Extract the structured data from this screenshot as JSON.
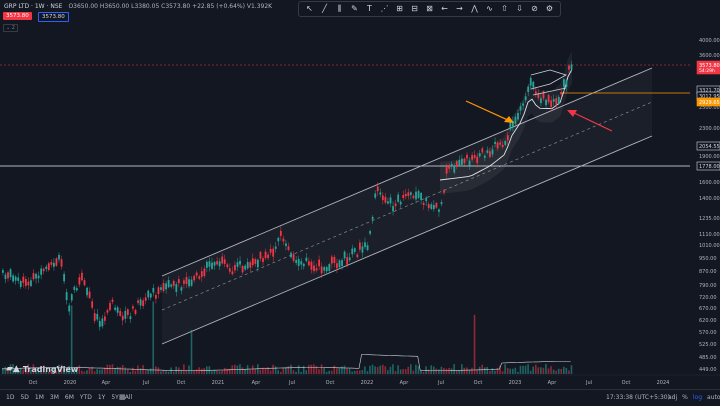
{
  "header": {
    "title": "GRP LTD · 1W · NSE",
    "ohlc": "O3650.00 H3650.00 L3380.05 C3573.80 +22.85 (+0.64%) V1.392K",
    "bid": "3573.80",
    "ask": "3573.80",
    "indicator": "⌄ 2"
  },
  "toolbar": {
    "icons": [
      "cursor-icon",
      "trend-line-icon",
      "fib-icon",
      "brush-icon",
      "text-icon",
      "pattern-icon",
      "measure-icon",
      "magnet-icon",
      "lock-icon",
      "arrow-left-icon",
      "arrow-right-icon",
      "zigzag-icon",
      "wave-icon",
      "up-arrow-icon",
      "down-arrow-icon",
      "eraser-icon",
      "settings-icon"
    ],
    "glyphs": [
      "↖",
      "╱",
      "⫼",
      "✎",
      "T",
      "⋰",
      "⊞",
      "⊟",
      "⊠",
      "←",
      "→",
      "⋀",
      "∿",
      "⇧",
      "⇩",
      "⊘",
      "⚙"
    ]
  },
  "price_axis": {
    "ticks": [
      "4000.00",
      "3600.00",
      "2800.00",
      "2500.00",
      "2300.00",
      "2000.00",
      "1900.00",
      "1600.00",
      "1400.00",
      "1235.00",
      "1110.00",
      "1010.00",
      "950.00",
      "870.00",
      "790.00",
      "720.00",
      "670.00",
      "620.00",
      "570.00",
      "525.00",
      "485.00",
      "449.00"
    ],
    "labels": [
      {
        "text": "3573.80",
        "sub": "54:29h",
        "color": "#f23645"
      },
      {
        "text": "3321.70",
        "color": "#d1d4dc"
      },
      {
        "text": "3012.95",
        "color": "#d1d4dc"
      },
      {
        "text": "2929.65",
        "color": "#ff9800"
      },
      {
        "text": "2054.55",
        "color": "#d1d4dc"
      },
      {
        "text": "1778.00",
        "color": "#d1d4dc"
      }
    ]
  },
  "time_axis": {
    "ticks": [
      "Oct",
      "2020",
      "Apr",
      "Jul",
      "Oct",
      "2021",
      "Apr",
      "Jul",
      "Oct",
      "2022",
      "Apr",
      "Jul",
      "Oct",
      "2023",
      "Apr",
      "Jul",
      "Oct",
      "2024"
    ]
  },
  "logo": {
    "text": "TradingView"
  },
  "bottom_bar": {
    "ranges": [
      "1D",
      "5D",
      "1M",
      "3M",
      "6M",
      "YTD",
      "1Y",
      "5Y",
      "All"
    ],
    "clock": "17:33:38 (UTC+5:30)",
    "options": [
      "adj",
      "%",
      "log",
      "auto"
    ]
  },
  "colors": {
    "bg": "#131722",
    "up": "#26a69a",
    "down": "#f23645",
    "orange": "#ff9800",
    "channel": "#b2b5be"
  }
}
